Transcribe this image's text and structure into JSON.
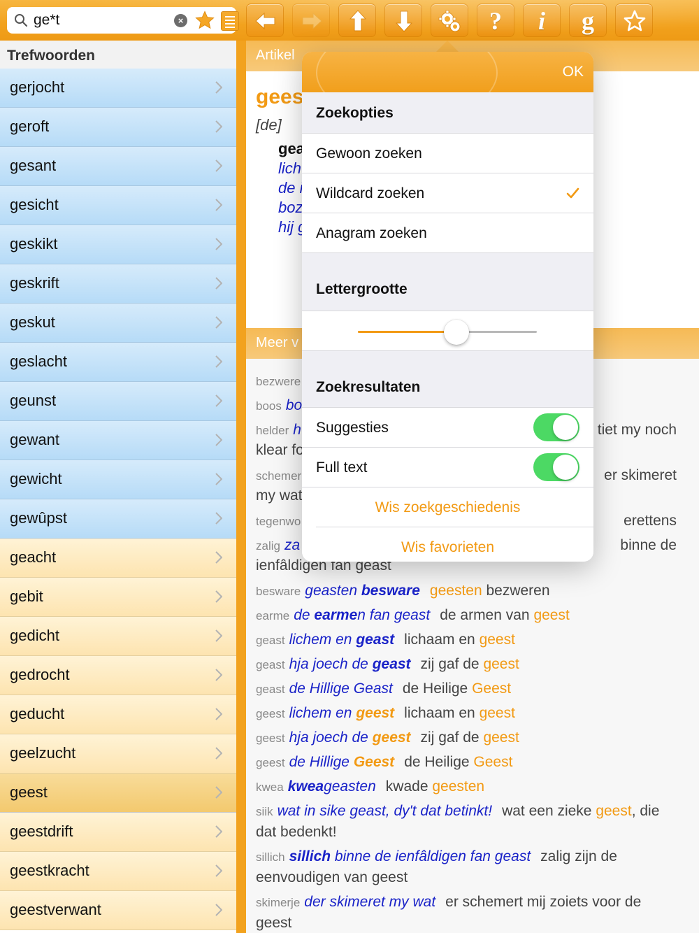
{
  "search": {
    "value": "ge*t",
    "clear_icon": "clear-icon",
    "favorites_icon": "star-icon",
    "history_icon": "list-icon"
  },
  "toolbar": {
    "buttons": [
      {
        "name": "back-button",
        "icon": "arrow-left-icon",
        "enabled": true
      },
      {
        "name": "forward-button",
        "icon": "arrow-right-icon",
        "enabled": false
      },
      {
        "name": "up-button",
        "icon": "arrow-up-icon",
        "enabled": true
      },
      {
        "name": "down-button",
        "icon": "arrow-down-icon",
        "enabled": true
      },
      {
        "name": "settings-button",
        "icon": "gears-icon",
        "enabled": true
      },
      {
        "name": "help-button",
        "icon": "question-icon",
        "enabled": true,
        "glyph": "?"
      },
      {
        "name": "info-button",
        "icon": "info-icon",
        "enabled": true,
        "glyph": "i"
      },
      {
        "name": "grammar-button",
        "icon": "g-icon",
        "enabled": true,
        "glyph": "g"
      },
      {
        "name": "favorite-button",
        "icon": "star-outline-icon",
        "enabled": true
      }
    ],
    "accent": "#f2a21e"
  },
  "sidebar": {
    "title": "Trefwoorden",
    "items": [
      {
        "label": "gerjocht",
        "style": "blue"
      },
      {
        "label": "geroft",
        "style": "blue"
      },
      {
        "label": "gesant",
        "style": "blue"
      },
      {
        "label": "gesicht",
        "style": "blue"
      },
      {
        "label": "geskikt",
        "style": "blue"
      },
      {
        "label": "geskrift",
        "style": "blue"
      },
      {
        "label": "geskut",
        "style": "blue"
      },
      {
        "label": "geslacht",
        "style": "blue"
      },
      {
        "label": "geunst",
        "style": "blue"
      },
      {
        "label": "gewant",
        "style": "blue"
      },
      {
        "label": "gewicht",
        "style": "blue"
      },
      {
        "label": "gewûpst",
        "style": "blue"
      },
      {
        "label": "geacht",
        "style": "yellow"
      },
      {
        "label": "gebit",
        "style": "yellow"
      },
      {
        "label": "gedicht",
        "style": "yellow"
      },
      {
        "label": "gedrocht",
        "style": "yellow"
      },
      {
        "label": "geducht",
        "style": "yellow"
      },
      {
        "label": "geelzucht",
        "style": "yellow"
      },
      {
        "label": "geest",
        "style": "selected"
      },
      {
        "label": "geestdrift",
        "style": "yellow"
      },
      {
        "label": "geestkracht",
        "style": "yellow"
      },
      {
        "label": "geestverwant",
        "style": "yellow"
      }
    ]
  },
  "article": {
    "header": "Artikel",
    "headword": "gees",
    "gram": "[de]",
    "examples": [
      "gea",
      "lich",
      "de i",
      "boz",
      "hij g"
    ],
    "more_header": "Meer v",
    "more_lines": [
      {
        "lemma": "bezwere",
        "parts": []
      },
      {
        "lemma": "boos",
        "parts": [
          {
            "cls": "fy",
            "t": "bo"
          }
        ]
      },
      {
        "lemma": "helder",
        "parts": [
          {
            "cls": "fy",
            "t": "h"
          }
        ],
        "right": "tiet my noch",
        "cont": "klear fo"
      },
      {
        "lemma": "schemer",
        "parts": [],
        "right": "er skimeret",
        "cont": "my wat"
      },
      {
        "lemma": "tegenwo",
        "parts": [],
        "right": "erettens"
      },
      {
        "lemma": "zalig",
        "parts": [
          {
            "cls": "fy",
            "t": "za"
          }
        ],
        "right": "binne de",
        "cont": "ienfâldigen fan geast"
      }
    ],
    "full_lines": [
      {
        "lemma": "besware",
        "fy": [
          {
            "t": "geasten "
          },
          {
            "t": "besware",
            "b": true
          }
        ],
        "nl": [
          {
            "t": "geesten",
            "hl": true
          },
          {
            "t": " bezweren"
          }
        ]
      },
      {
        "lemma": "earme",
        "fy": [
          {
            "t": "de "
          },
          {
            "t": "earme",
            "b": true
          },
          {
            "t": "n fan geast"
          }
        ],
        "nl": [
          {
            "t": "de armen van "
          },
          {
            "t": "geest",
            "hl": true
          }
        ]
      },
      {
        "lemma": "geast",
        "fy": [
          {
            "t": "lichem en "
          },
          {
            "t": "geast",
            "b": true
          }
        ],
        "nl": [
          {
            "t": "lichaam en "
          },
          {
            "t": "geest",
            "hl": true
          }
        ]
      },
      {
        "lemma": "geast",
        "fy": [
          {
            "t": "hja joech de "
          },
          {
            "t": "geast",
            "b": true
          }
        ],
        "nl": [
          {
            "t": "zij gaf de "
          },
          {
            "t": "geest",
            "hl": true
          }
        ]
      },
      {
        "lemma": "geast",
        "fy": [
          {
            "t": "de Hillige Geast"
          }
        ],
        "nl": [
          {
            "t": "de Heilige "
          },
          {
            "t": "Geest",
            "hl": true
          }
        ]
      },
      {
        "lemma": "geest",
        "fy": [
          {
            "t": "lichem en "
          },
          {
            "t": "geest",
            "hlb": true
          }
        ],
        "nl": [
          {
            "t": "lichaam en "
          },
          {
            "t": "geest",
            "hl": true
          }
        ]
      },
      {
        "lemma": "geest",
        "fy": [
          {
            "t": "hja joech de "
          },
          {
            "t": "geest",
            "hlb": true
          }
        ],
        "nl": [
          {
            "t": "zij gaf de "
          },
          {
            "t": "geest",
            "hl": true
          }
        ]
      },
      {
        "lemma": "geest",
        "fy": [
          {
            "t": "de Hillige "
          },
          {
            "t": "Geest",
            "hlb": true
          }
        ],
        "nl": [
          {
            "t": "de Heilige "
          },
          {
            "t": "Geest",
            "hl": true
          }
        ]
      },
      {
        "lemma": "kwea",
        "fy": [
          {
            "t": "kwea",
            "b": true
          },
          {
            "t": "geasten"
          }
        ],
        "nl": [
          {
            "t": "kwade "
          },
          {
            "t": "geesten",
            "hl": true
          }
        ]
      },
      {
        "lemma": "siik",
        "fy": [
          {
            "t": "wat in sike geast, dy't dat betinkt!"
          }
        ],
        "nl": [
          {
            "t": "wat een zieke "
          },
          {
            "t": "geest",
            "hl": true
          },
          {
            "t": ", die"
          }
        ],
        "cont": [
          {
            "t": "dat bedenkt!"
          }
        ]
      },
      {
        "lemma": "sillich",
        "fy": [
          {
            "t": "sillich",
            "b": true
          },
          {
            "t": " binne de ienfâldigen fan geast"
          }
        ],
        "nl": [
          {
            "t": "zalig zijn de"
          }
        ],
        "cont": [
          {
            "t": "eenvoudigen van "
          },
          {
            "t": "geest",
            "hl": true
          }
        ]
      },
      {
        "lemma": "skimerje",
        "fy": [
          {
            "t": "der skimeret my wat"
          }
        ],
        "nl": [
          {
            "t": "er schemert mij zoiets voor de"
          }
        ],
        "cont": [
          {
            "t": "geest",
            "hl": true
          }
        ]
      }
    ]
  },
  "settings": {
    "ok_label": "OK",
    "search_options_title": "Zoekopties",
    "search_options": [
      {
        "label": "Gewoon zoeken",
        "checked": false
      },
      {
        "label": "Wildcard zoeken",
        "checked": true
      },
      {
        "label": "Anagram zoeken",
        "checked": false
      }
    ],
    "font_size_title": "Lettergrootte",
    "font_size_level": 0.55,
    "results_title": "Zoekresultaten",
    "toggles": [
      {
        "label": "Suggesties",
        "on": true
      },
      {
        "label": "Full text",
        "on": true
      }
    ],
    "clear_history_label": "Wis zoekgeschiedenis",
    "clear_favorites_label": "Wis favorieten",
    "toggle_color": "#4cd964"
  }
}
